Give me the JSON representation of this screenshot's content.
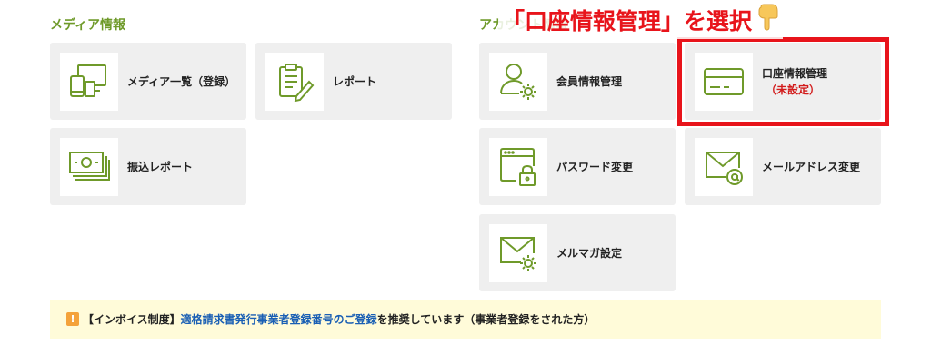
{
  "sections": {
    "media": "メディア情報",
    "account": "アカウント情報"
  },
  "cards": {
    "media_list": "メディア一覧（登録）",
    "report": "レポート",
    "transfer_report": "振込レポート",
    "member_info": "会員情報管理",
    "bank_account": "口座情報管理",
    "bank_account_status": "（未設定）",
    "password": "パスワード変更",
    "email": "メールアドレス変更",
    "newsletter": "メルマガ設定"
  },
  "annotation": "「口座情報管理」を選択",
  "notice": {
    "icon": "!",
    "prefix": "【インボイス制度】",
    "link": "適格請求書発行事業者登録番号のご登録",
    "suffix": "を推奨しています（事業者登録をされた方）"
  },
  "colors": {
    "accent_green": "#6f9a2a",
    "highlight_red": "#e8141b",
    "link_blue": "#1a5fb4",
    "notice_bg": "#fffbd9"
  },
  "icons": [
    "devices-icon",
    "clipboard-edit-icon",
    "cash-stack-icon",
    "user-gear-icon",
    "credit-card-icon",
    "browser-lock-icon",
    "mail-at-icon",
    "mail-gear-icon",
    "pointing-hand-icon",
    "warning-icon"
  ]
}
